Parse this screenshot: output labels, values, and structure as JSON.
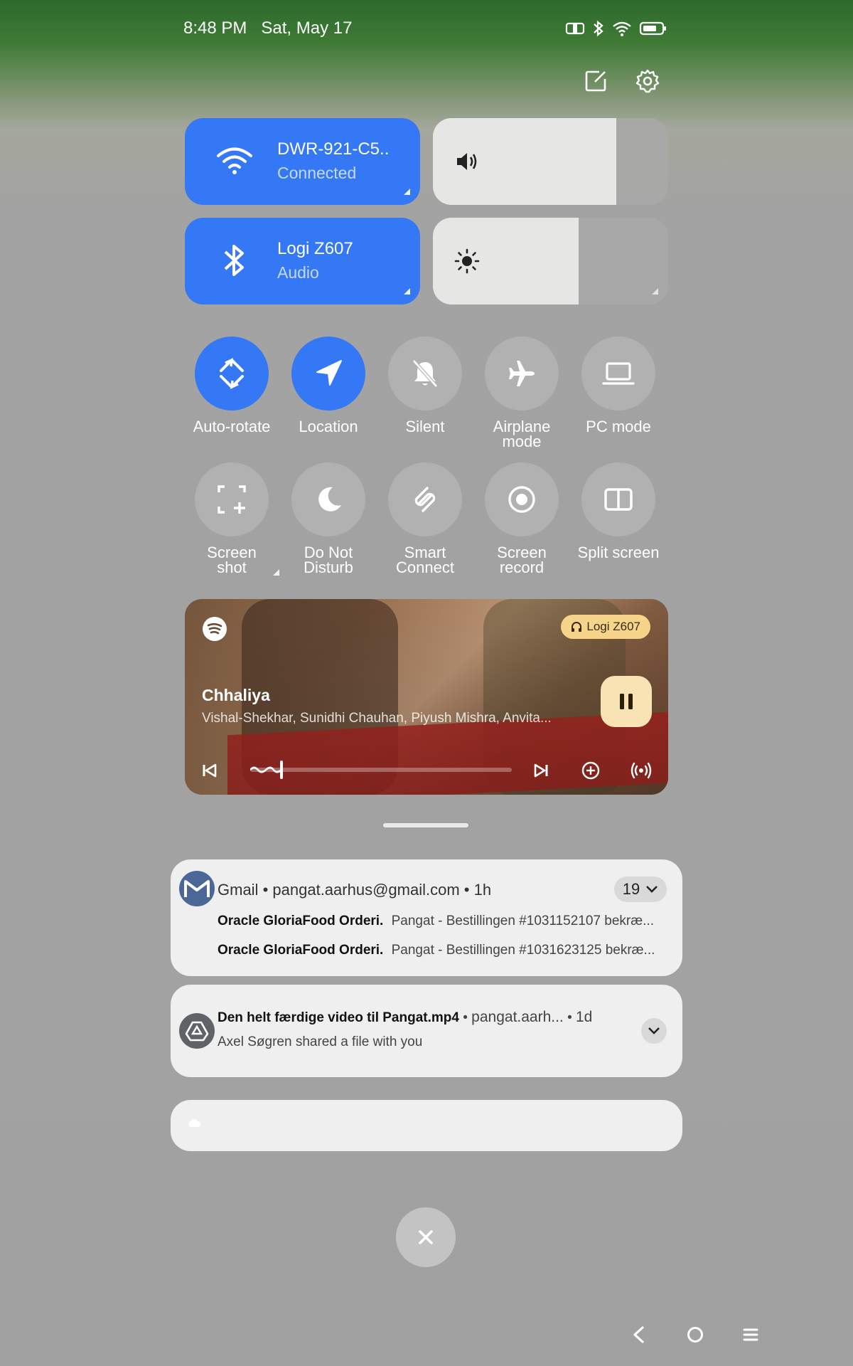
{
  "status_bar": {
    "time": "8:48 PM",
    "date": "Sat, May 17",
    "icons": [
      "vibrate-icon",
      "bluetooth-icon",
      "wifi-icon",
      "battery-icon"
    ]
  },
  "header_actions": [
    "edit-icon",
    "settings-icon"
  ],
  "tiles": {
    "wifi": {
      "name": "DWR-921-C5..",
      "status": "Connected",
      "icon": "wifi-icon"
    },
    "bluetooth": {
      "name": "Logi Z607",
      "status": "Audio",
      "icon": "bluetooth-icon"
    },
    "volume": {
      "level": 0.78,
      "icon": "volume-icon"
    },
    "brightness": {
      "level": 0.62,
      "icon": "brightness-icon"
    }
  },
  "toggles": [
    {
      "label": "Auto-rotate",
      "on": true,
      "icon": "auto-rotate-icon"
    },
    {
      "label": "Location",
      "on": true,
      "icon": "location-icon"
    },
    {
      "label": "Silent",
      "on": false,
      "icon": "silent-bell-icon"
    },
    {
      "label": "Airplane mode",
      "on": false,
      "icon": "airplane-icon"
    },
    {
      "label": "PC mode",
      "on": false,
      "icon": "laptop-icon"
    },
    {
      "label": "Screen shot",
      "on": false,
      "icon": "screenshot-icon"
    },
    {
      "label": "Do Not Disturb",
      "on": false,
      "icon": "moon-icon"
    },
    {
      "label": "Smart Connect",
      "on": false,
      "icon": "smart-connect-icon"
    },
    {
      "label": "Screen record",
      "on": false,
      "icon": "record-icon"
    },
    {
      "label": "Split screen",
      "on": false,
      "icon": "split-screen-icon"
    }
  ],
  "media": {
    "app_icon": "spotify-icon",
    "device_badge": "Logi Z607",
    "title": "Chhaliya",
    "artists": "Vishal-Shekhar, Sunidhi Chauhan, Piyush Mishra, Anvita...",
    "progress": 0.12,
    "accent": "#f6d48a"
  },
  "notifications": {
    "gmail": {
      "app": "Gmail",
      "account": "pangat.aarhus@gmail.com",
      "time": "1h",
      "count": "19",
      "messages": [
        {
          "sender": "Oracle GloriaFood Orderi.",
          "subject": "Pangat - Bestillingen #1031152107 bekræ..."
        },
        {
          "sender": "Oracle GloriaFood Orderi.",
          "subject": "Pangat - Bestillingen #1031623125 bekræ..."
        }
      ]
    },
    "drive": {
      "title": "Den helt færdige video til Pangat.mp4",
      "account": "pangat.aarh...",
      "time": "1d",
      "body": "Axel Søgren shared a file with you"
    }
  },
  "colors": {
    "accent": "#3478f6",
    "card": "#efefef"
  }
}
